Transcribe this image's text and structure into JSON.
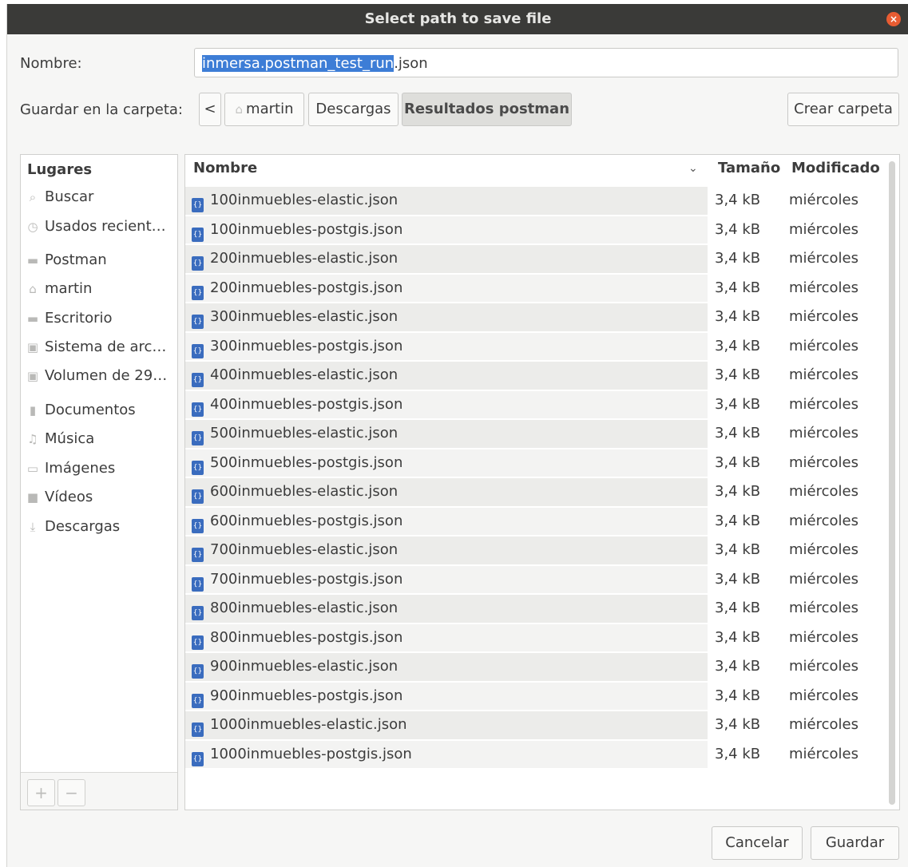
{
  "title": "Select path to save file",
  "name_label": "Nombre:",
  "name_selected": "inmersa.postman_test_run",
  "name_rest": ".json",
  "folder_label": "Guardar en la carpeta:",
  "path": {
    "back": "<",
    "crumbs": [
      "martin",
      "Descargas",
      "Resultados postman"
    ]
  },
  "create_folder": "Crear carpeta",
  "places": {
    "heading": "Lugares",
    "items": [
      {
        "label": "Buscar",
        "icon": "search-icon"
      },
      {
        "label": "Usados recient…",
        "icon": "clock-icon"
      },
      {
        "label": "Postman",
        "icon": "folder-icon"
      },
      {
        "label": "martin",
        "icon": "home-icon"
      },
      {
        "label": "Escritorio",
        "icon": "desktop-icon"
      },
      {
        "label": "Sistema de arc…",
        "icon": "drive-icon"
      },
      {
        "label": "Volumen de 29…",
        "icon": "drive-icon"
      },
      {
        "label": "Documentos",
        "icon": "document-icon"
      },
      {
        "label": "Música",
        "icon": "music-icon"
      },
      {
        "label": "Imágenes",
        "icon": "image-icon"
      },
      {
        "label": "Vídeos",
        "icon": "video-icon"
      },
      {
        "label": "Descargas",
        "icon": "download-icon"
      }
    ],
    "add": "+",
    "remove": "−"
  },
  "columns": {
    "name": "Nombre",
    "size": "Tamaño",
    "modified": "Modificado"
  },
  "files": [
    {
      "name": "100inmuebles-elastic.json",
      "size": "3,4 kB",
      "modified": "miércoles"
    },
    {
      "name": "100inmuebles-postgis.json",
      "size": "3,4 kB",
      "modified": "miércoles"
    },
    {
      "name": "200inmuebles-elastic.json",
      "size": "3,4 kB",
      "modified": "miércoles"
    },
    {
      "name": "200inmuebles-postgis.json",
      "size": "3,4 kB",
      "modified": "miércoles"
    },
    {
      "name": "300inmuebles-elastic.json",
      "size": "3,4 kB",
      "modified": "miércoles"
    },
    {
      "name": "300inmuebles-postgis.json",
      "size": "3,4 kB",
      "modified": "miércoles"
    },
    {
      "name": "400inmuebles-elastic.json",
      "size": "3,4 kB",
      "modified": "miércoles"
    },
    {
      "name": "400inmuebles-postgis.json",
      "size": "3,4 kB",
      "modified": "miércoles"
    },
    {
      "name": "500inmuebles-elastic.json",
      "size": "3,4 kB",
      "modified": "miércoles"
    },
    {
      "name": "500inmuebles-postgis.json",
      "size": "3,4 kB",
      "modified": "miércoles"
    },
    {
      "name": "600inmuebles-elastic.json",
      "size": "3,4 kB",
      "modified": "miércoles"
    },
    {
      "name": "600inmuebles-postgis.json",
      "size": "3,4 kB",
      "modified": "miércoles"
    },
    {
      "name": "700inmuebles-elastic.json",
      "size": "3,4 kB",
      "modified": "miércoles"
    },
    {
      "name": "700inmuebles-postgis.json",
      "size": "3,4 kB",
      "modified": "miércoles"
    },
    {
      "name": "800inmuebles-elastic.json",
      "size": "3,4 kB",
      "modified": "miércoles"
    },
    {
      "name": "800inmuebles-postgis.json",
      "size": "3,4 kB",
      "modified": "miércoles"
    },
    {
      "name": "900inmuebles-elastic.json",
      "size": "3,4 kB",
      "modified": "miércoles"
    },
    {
      "name": "900inmuebles-postgis.json",
      "size": "3,4 kB",
      "modified": "miércoles"
    },
    {
      "name": "1000inmuebles-elastic.json",
      "size": "3,4 kB",
      "modified": "miércoles"
    },
    {
      "name": "1000inmuebles-postgis.json",
      "size": "3,4 kB",
      "modified": "miércoles"
    }
  ],
  "buttons": {
    "cancel": "Cancelar",
    "save": "Guardar"
  },
  "colors": {
    "titlebar": "#3a3a38",
    "selection": "#3d7dd6",
    "close": "#e85c32",
    "file_icon": "#3a6cbe"
  }
}
